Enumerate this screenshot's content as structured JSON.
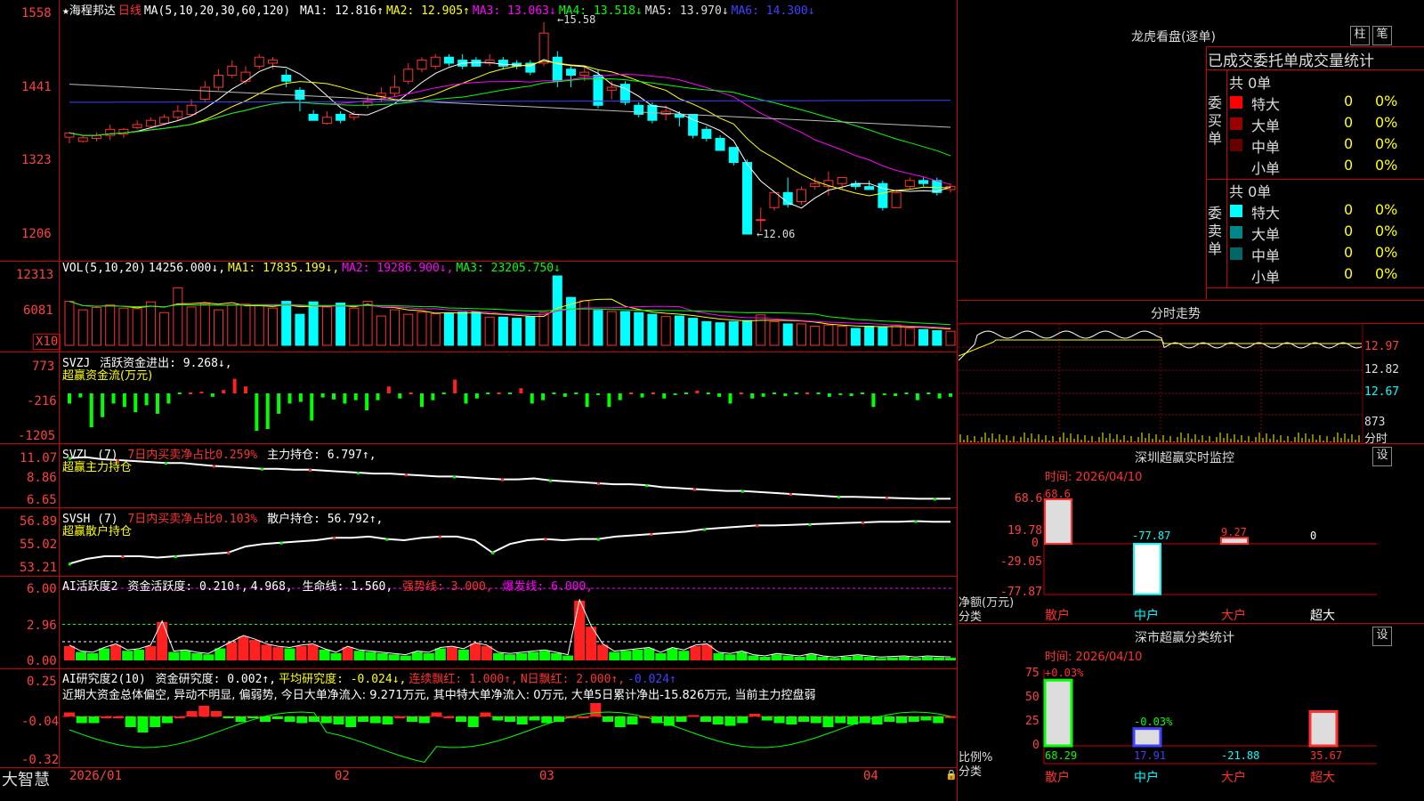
{
  "stock": {
    "name": "★海程邦达",
    "period": "日线",
    "ma_label": "MA(5,10,20,30,60,120)",
    "ma_values": [
      {
        "label": "MA1:",
        "value": "12.816",
        "arrow": "↑",
        "color": "#ffffff"
      },
      {
        "label": "MA2:",
        "value": "12.905",
        "arrow": "↑",
        "color": "#ffff00"
      },
      {
        "label": "MA3:",
        "value": "13.063",
        "arrow": "↓",
        "color": "#ff00ff"
      },
      {
        "label": "MA4:",
        "value": "13.518",
        "arrow": "↓",
        "color": "#00ff00"
      },
      {
        "label": "MA5:",
        "value": "13.970",
        "arrow": "↓",
        "color": "#dddddd"
      },
      {
        "label": "MA6:",
        "value": "14.300",
        "arrow": "↓",
        "color": "#4040ff"
      }
    ],
    "high_mark": "15.58",
    "low_mark": "12.06"
  },
  "price_axis": [
    "1558",
    "1441",
    "1323",
    "1206"
  ],
  "vol": {
    "header": "VOL(5,10,20)",
    "value": "14256.000↓,",
    "ma1": "MA1: 17835.199↓,",
    "ma2": "MA2: 19286.900↓,",
    "ma3": "MA3: 23205.750↓",
    "axis": [
      "12313",
      "6081"
    ],
    "unit": "X10"
  },
  "svzj": {
    "header": "SVZJ",
    "text": "活跃资金进出: 9.268↓,",
    "sub": "超赢资金流(万元)",
    "axis": [
      "773",
      "-216",
      "-1205"
    ]
  },
  "svzl": {
    "header": "SVZL (7)",
    "text1": "7日内买卖净占比0.259%",
    "text2": "主力持仓: 6.797↑,",
    "sub": "超赢主力持仓",
    "axis": [
      "11.07",
      "8.86",
      "6.65"
    ]
  },
  "svsh": {
    "header": "SVSH (7)",
    "text1": "7日内买卖净占比0.103%",
    "text2": "散户持仓: 56.792↑,",
    "sub": "超赢散户持仓",
    "axis": [
      "56.89",
      "55.02",
      "53.21"
    ]
  },
  "ai1": {
    "header": "AI活跃度2",
    "t1": "资金活跃度: 0.210↑,",
    "t2": "4.968,",
    "t3": "生命线: 1.560,",
    "t4": "强势线: 3.000,",
    "t5": "爆发线: 6.000,",
    "axis": [
      "6.00",
      "2.96",
      "0.00"
    ]
  },
  "ai2": {
    "header": "AI研究度2(10)",
    "t1": "资金研究度: 0.002↑,",
    "t2": "平均研究度: -0.024↓,",
    "t3": "连续飘红: 1.000↑,",
    "t4": "N日飘红: 2.000↑,",
    "t5": "-0.024↑",
    "comment": "近期大资金总体偏空, 异动不明显, 偏弱势, 今日大单净流入: 9.271万元, 其中特大单净流入: 0万元, 大单5日累计净出-15.826万元, 当前主力控盘弱",
    "axis": [
      "0.25",
      "-0.04",
      "-0.32"
    ]
  },
  "date_axis": [
    "2026/01",
    "02",
    "03",
    "04"
  ],
  "brand": "大智慧",
  "right": {
    "lhb_title": "龙虎看盘(逐单)",
    "btn_zhu": "柱",
    "btn_bi": "笔",
    "tabs_label": "已成交委托单成交量统计",
    "buy_label": "委买单",
    "sell_label": "委卖单",
    "buy_total": "共 0单",
    "sell_total": "共 0单",
    "buy_rows": [
      {
        "name": "特大",
        "n": "0",
        "p": "0%",
        "color": "#ff0000"
      },
      {
        "name": "大单",
        "n": "0",
        "p": "0%",
        "color": "#990000"
      },
      {
        "name": "中单",
        "n": "0",
        "p": "0%",
        "color": "#660000"
      },
      {
        "name": "小单",
        "n": "0",
        "p": "0%",
        "color": ""
      }
    ],
    "sell_rows": [
      {
        "name": "特大",
        "n": "0",
        "p": "0%",
        "color": "#00ffff"
      },
      {
        "name": "大单",
        "n": "0",
        "p": "0%",
        "color": "#008888"
      },
      {
        "name": "中单",
        "n": "0",
        "p": "0%",
        "color": "#006666"
      },
      {
        "name": "小单",
        "n": "0",
        "p": "0%",
        "color": ""
      }
    ],
    "fs_title": "分时走势",
    "fs_axis": [
      "12.97",
      "12.82",
      "12.67",
      "873",
      "分时"
    ],
    "sz_title": "深圳超赢实时监控",
    "sz_btn": "设",
    "sz_time": "时间: 2026/04/10",
    "sz_axis": [
      "68.6",
      "19.78",
      "0",
      "-29.05",
      "-77.87"
    ],
    "sz_ylabel1": "净额(万元)",
    "sz_ylabel2": "分类",
    "sz_values": [
      {
        "label": "68.6",
        "value": 68.6
      },
      {
        "label": "-77.87",
        "value": -77.87
      },
      {
        "label": "9.27",
        "value": 9.27
      },
      {
        "label": "0",
        "value": 0
      }
    ],
    "sz_cats": [
      "散户",
      "中户",
      "大户",
      "超大"
    ],
    "cls_title": "深市超赢分类统计",
    "cls_btn": "设",
    "cls_time": "时间: 2026/04/10",
    "cls_axis": [
      "75",
      "50",
      "25",
      "0"
    ],
    "cls_ylabel1": "比例%",
    "cls_ylabel2": "分类",
    "cls_top": [
      {
        "label": "+0.03%"
      },
      {
        "label": "-0.03%"
      }
    ],
    "cls_values": [
      {
        "label": "68.29",
        "value": 68.29
      },
      {
        "label": "17.91",
        "value": 17.91
      },
      {
        "label": "-21.88",
        "value": -21.88
      },
      {
        "label": "35.67",
        "value": 35.67
      }
    ],
    "cls_cats": [
      "散户",
      "中户",
      "大户",
      "超大"
    ]
  },
  "chart_data": [
    {
      "type": "candlestick",
      "title": "海程邦达 日线",
      "ylim": [
        12.06,
        15.58
      ],
      "candles": [
        [
          13.67,
          13.74,
          13.57,
          13.76
        ],
        [
          13.6,
          13.66,
          13.58,
          13.71
        ],
        [
          13.65,
          13.7,
          13.6,
          13.75
        ],
        [
          13.7,
          13.8,
          13.62,
          13.88
        ],
        [
          13.72,
          13.8,
          13.66,
          13.82
        ],
        [
          13.83,
          13.88,
          13.8,
          13.95
        ],
        [
          13.85,
          13.95,
          13.82,
          14.0
        ],
        [
          13.9,
          14.0,
          13.87,
          14.05
        ],
        [
          14.0,
          14.1,
          13.95,
          14.2
        ],
        [
          14.05,
          14.2,
          14.02,
          14.3
        ],
        [
          14.3,
          14.5,
          14.25,
          14.6
        ],
        [
          14.5,
          14.7,
          14.45,
          14.8
        ],
        [
          14.7,
          14.85,
          14.65,
          14.95
        ],
        [
          14.6,
          14.75,
          14.55,
          14.85
        ],
        [
          14.85,
          15.0,
          14.8,
          15.05
        ],
        [
          14.9,
          14.95,
          14.8,
          15.0
        ],
        [
          14.7,
          14.6,
          14.5,
          14.8
        ],
        [
          14.45,
          14.3,
          14.1,
          14.5
        ],
        [
          14.05,
          13.95,
          13.95,
          14.12
        ],
        [
          13.9,
          14.0,
          13.88,
          14.1
        ],
        [
          14.05,
          13.95,
          13.9,
          14.1
        ],
        [
          14.0,
          14.05,
          13.95,
          14.1
        ],
        [
          14.2,
          14.25,
          14.15,
          14.35
        ],
        [
          14.35,
          14.4,
          14.25,
          14.5
        ],
        [
          14.4,
          14.5,
          14.35,
          14.7
        ],
        [
          14.6,
          14.8,
          14.55,
          14.9
        ],
        [
          14.8,
          14.95,
          14.75,
          15.0
        ],
        [
          14.85,
          15.0,
          14.8,
          15.05
        ],
        [
          15.0,
          14.9,
          14.85,
          15.05
        ],
        [
          14.95,
          14.85,
          14.8,
          15.05
        ],
        [
          14.95,
          14.85,
          14.85,
          15.0
        ],
        [
          14.9,
          14.95,
          14.85,
          15.05
        ],
        [
          14.95,
          14.85,
          14.8,
          15.0
        ],
        [
          14.9,
          14.85,
          14.8,
          14.95
        ],
        [
          14.9,
          14.75,
          14.7,
          14.95
        ],
        [
          14.9,
          15.4,
          14.85,
          15.58
        ],
        [
          15.0,
          14.6,
          14.5,
          15.1
        ],
        [
          14.8,
          14.7,
          14.5,
          14.85
        ],
        [
          14.7,
          14.75,
          14.6,
          14.85
        ],
        [
          14.7,
          14.2,
          14.15,
          14.8
        ],
        [
          14.45,
          14.5,
          14.3,
          14.6
        ],
        [
          14.55,
          14.25,
          14.2,
          14.6
        ],
        [
          14.2,
          14.05,
          14.0,
          14.25
        ],
        [
          14.2,
          13.95,
          13.9,
          14.25
        ],
        [
          14.05,
          14.1,
          13.95,
          14.2
        ],
        [
          14.05,
          14.0,
          13.85,
          14.1
        ],
        [
          14.05,
          13.7,
          13.65,
          14.05
        ],
        [
          13.8,
          13.65,
          13.6,
          13.85
        ],
        [
          13.65,
          13.45,
          13.45,
          13.7
        ],
        [
          13.5,
          13.25,
          13.2,
          13.5
        ],
        [
          13.25,
          12.06,
          12.06,
          13.3
        ],
        [
          12.3,
          12.3,
          12.1,
          12.5
        ],
        [
          12.5,
          12.75,
          12.45,
          12.75
        ],
        [
          12.75,
          12.55,
          12.5,
          13.0
        ],
        [
          12.6,
          12.8,
          12.55,
          12.85
        ],
        [
          12.85,
          12.9,
          12.8,
          13.0
        ],
        [
          12.85,
          12.95,
          12.7,
          13.1
        ],
        [
          12.9,
          13.0,
          12.8,
          13.0
        ],
        [
          12.9,
          12.85,
          12.8,
          12.95
        ],
        [
          12.85,
          12.8,
          12.8,
          12.95
        ],
        [
          12.9,
          12.5,
          12.45,
          12.95
        ],
        [
          12.5,
          12.75,
          12.5,
          12.8
        ],
        [
          12.85,
          12.95,
          12.8,
          13.0
        ],
        [
          12.95,
          12.9,
          12.85,
          13.0
        ],
        [
          12.95,
          12.75,
          12.7,
          13.0
        ],
        [
          12.8,
          12.85,
          12.75,
          12.9
        ]
      ]
    },
    {
      "type": "bar",
      "title": "VOL(5,10,20)",
      "ylim": [
        0,
        12313
      ],
      "values": [
        7800,
        6300,
        6700,
        7200,
        6600,
        6500,
        7700,
        5800,
        10200,
        6800,
        7400,
        6300,
        7200,
        7300,
        7000,
        6600,
        7800,
        5500,
        7700,
        6800,
        7500,
        6600,
        7800,
        5200,
        6300,
        5500,
        5900,
        5600,
        5600,
        5900,
        5900,
        5000,
        5000,
        4800,
        5100,
        5800,
        12313,
        8500,
        7900,
        6200,
        6000,
        6000,
        5800,
        5500,
        5100,
        5200,
        4800,
        4200,
        4000,
        4200,
        4400,
        5400,
        4200,
        3800,
        3800,
        3400,
        3600,
        3400,
        3000,
        3400,
        3200,
        3600,
        3000,
        2800,
        2600,
        2500
      ]
    },
    {
      "type": "bar",
      "title": "超赢资金流(万元)",
      "ylim": [
        -1205,
        773
      ],
      "values": [
        -300,
        -120,
        -1000,
        -700,
        -300,
        -400,
        -550,
        -350,
        -600,
        -300,
        0,
        0,
        50,
        -100,
        100,
        420,
        200,
        -1100,
        -1050,
        -600,
        -300,
        -250,
        -800,
        -120,
        -180,
        -300,
        -200,
        -500,
        -200,
        200,
        -150,
        0,
        -400,
        -200,
        0,
        400,
        -300,
        -150,
        0,
        0,
        0,
        150,
        -300,
        -200,
        0,
        -100,
        0,
        -400,
        -50,
        -400,
        -200,
        0,
        -120,
        0,
        -150,
        -50,
        0,
        80,
        0,
        -100,
        -300,
        0,
        -150,
        -100,
        0,
        -80,
        0,
        0,
        0,
        -100,
        -50,
        -80,
        0,
        -400,
        -50,
        -80,
        0,
        -200,
        0,
        -150,
        -100
      ]
    },
    {
      "type": "line",
      "title": "超赢主力持仓",
      "ylim": [
        6.65,
        11.07
      ],
      "values": [
        11.0,
        11.1,
        10.9,
        10.8,
        10.7,
        10.6,
        10.5,
        10.5,
        10.35,
        10.2,
        10.1,
        10.0,
        9.9,
        9.9,
        9.8,
        9.8,
        9.7,
        9.6,
        9.5,
        9.4,
        9.4,
        9.3,
        9.2,
        9.1,
        9.1,
        9.0,
        8.9,
        8.8,
        8.8,
        8.9,
        8.7,
        8.6,
        8.5,
        8.4,
        8.3,
        8.3,
        8.2,
        8.0,
        7.9,
        7.8,
        7.7,
        7.6,
        7.6,
        7.5,
        7.4,
        7.3,
        7.2,
        7.1,
        7.0,
        7.0,
        6.95,
        6.9,
        6.85,
        6.8,
        6.8,
        6.8
      ]
    },
    {
      "type": "line",
      "title": "超赢散户持仓",
      "ylim": [
        53.21,
        56.89
      ],
      "values": [
        53.4,
        53.8,
        54.0,
        54.0,
        54.0,
        53.9,
        54.0,
        54.1,
        54.2,
        54.3,
        54.8,
        55.0,
        55.1,
        55.2,
        55.3,
        55.5,
        55.5,
        55.6,
        55.4,
        55.3,
        55.5,
        55.6,
        55.6,
        55.3,
        54.3,
        55.0,
        55.3,
        55.4,
        55.3,
        55.4,
        55.4,
        55.6,
        55.7,
        55.8,
        55.9,
        56.0,
        56.2,
        56.3,
        56.4,
        56.5,
        56.5,
        56.55,
        56.6,
        56.65,
        56.7,
        56.75,
        56.8,
        56.8,
        56.85,
        56.8,
        56.8
      ]
    },
    {
      "type": "bar",
      "title": "AI活跃度2",
      "ylim": [
        0,
        6.0
      ],
      "values": [
        1.2,
        0.7,
        0.6,
        1.0,
        1.3,
        0.8,
        0.9,
        1.2,
        3.2,
        0.7,
        0.8,
        0.6,
        0.5,
        1.0,
        1.5,
        2.0,
        1.7,
        1.3,
        1.1,
        1.0,
        1.2,
        1.3,
        0.9,
        0.6,
        1.1,
        0.8,
        0.7,
        0.6,
        0.5,
        0.4,
        0.7,
        0.6,
        1.0,
        1.1,
        0.9,
        1.4,
        1.2,
        0.6,
        0.5,
        0.6,
        0.7,
        0.8,
        0.6,
        0.4,
        4.97,
        2.8,
        1.3,
        0.7,
        0.8,
        0.9,
        1.0,
        0.6,
        1.0,
        0.8,
        1.2,
        1.3,
        0.6,
        0.5,
        0.7,
        0.4,
        0.3,
        0.5,
        0.4,
        0.3,
        0.5,
        0.3,
        0.2,
        0.3,
        0.4,
        0.3,
        0.2,
        0.25,
        0.3,
        0.2,
        0.3,
        0.25,
        0.21
      ]
    },
    {
      "type": "bar",
      "title": "AI研究度2(10)",
      "ylim": [
        -0.32,
        0.25
      ],
      "values": [
        0.03,
        -0.05,
        -0.05,
        0.0,
        0.0,
        -0.08,
        -0.12,
        -0.08,
        -0.05,
        0.0,
        0.04,
        0.08,
        0.04,
        -0.01,
        -0.04,
        -0.01,
        -0.04,
        -0.02,
        -0.04,
        -0.05,
        -0.04,
        -0.05,
        -0.06,
        -0.08,
        -0.04,
        -0.05,
        -0.06,
        0.0,
        -0.04,
        -0.05,
        0.03,
        0.0,
        -0.04,
        -0.08,
        0.03,
        -0.03,
        -0.04,
        -0.06,
        -0.03,
        -0.05,
        -0.04,
        0.0,
        0.0,
        0.1,
        -0.04,
        -0.08,
        -0.06,
        0.0,
        -0.05,
        -0.07,
        -0.04,
        0.01,
        -0.04,
        -0.06,
        -0.07,
        -0.05,
        0.02,
        -0.03,
        -0.05,
        -0.06,
        -0.04,
        -0.05,
        -0.08,
        -0.05,
        -0.06,
        -0.05,
        -0.06,
        -0.04,
        -0.05,
        -0.04,
        -0.03,
        -0.05,
        0.002
      ]
    }
  ]
}
